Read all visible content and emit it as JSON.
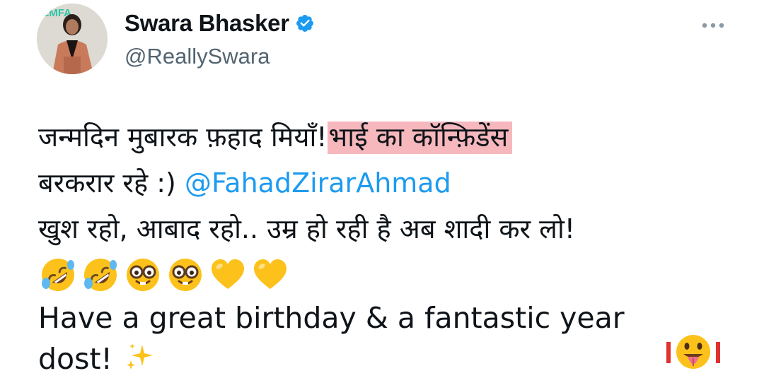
{
  "author": {
    "display_name": "Swara Bhasker",
    "handle": "@ReallySwara",
    "verified": true,
    "avatar_badge_text": "ILMFA"
  },
  "tweet": {
    "line1_text": "जन्मदिन मुबारक फ़हाद मियाँ!",
    "line1_highlight": "भाई का कॉन्फ़िडेंस",
    "line2_text": "बरकरार रहे :) ",
    "mention": "@FahadZirarAhmad",
    "line3_text": "खुश रहो, आबाद रहो..  उम्र हो रही है अब शादी कर लो!",
    "emojis": [
      "rofl-emoji",
      "rofl-emoji",
      "nerd-face-emoji",
      "nerd-face-emoji",
      "yellow-heart-emoji",
      "yellow-heart-emoji"
    ],
    "line4_text": "Have a great birthday & a fantastic year",
    "line5_text": "dost!",
    "trailing_emojis": [
      "sparkles-emoji",
      "tongue-face-emoji"
    ]
  },
  "colors": {
    "text": "#0f1419",
    "secondary": "#536471",
    "link": "#1d9bf0",
    "verified": "#1d9bf0",
    "highlight": "#f6b8bd",
    "emoji_yellow": "#fcc21b"
  }
}
